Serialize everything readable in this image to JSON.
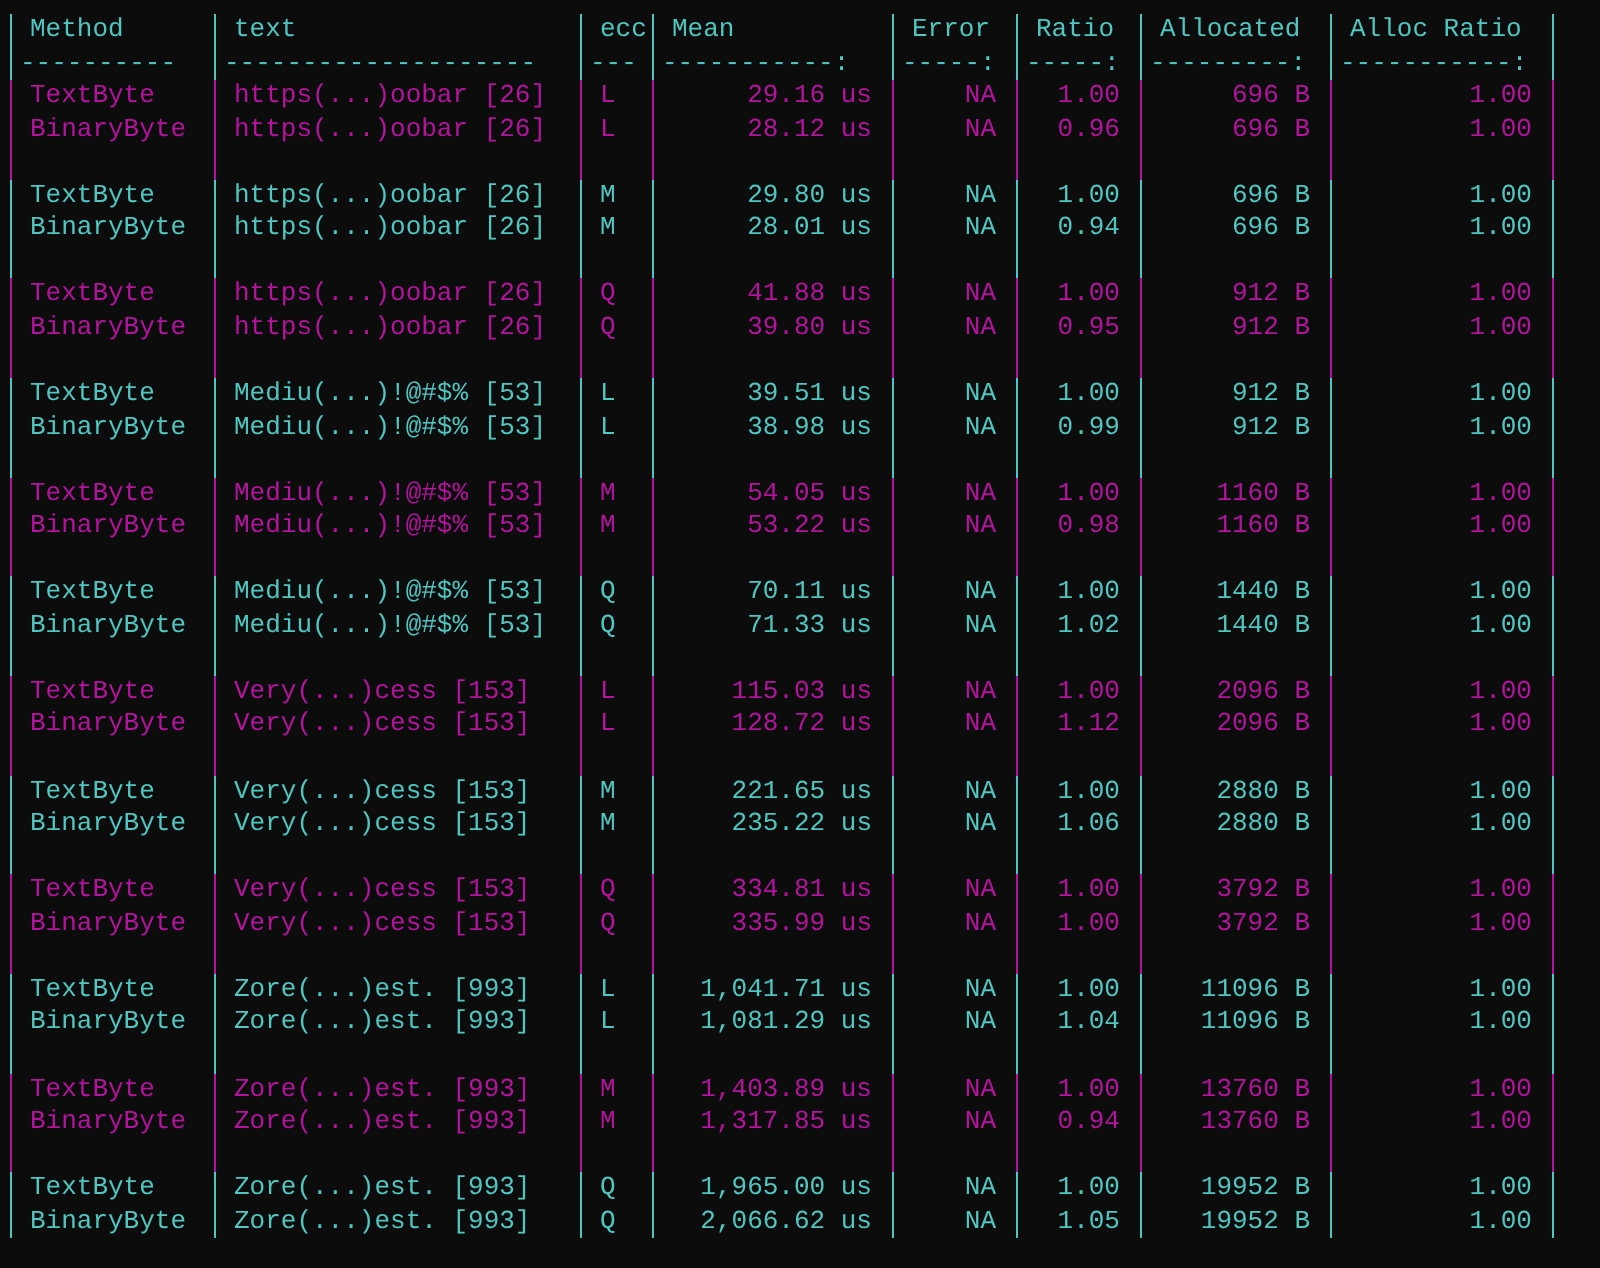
{
  "table": {
    "columns": [
      {
        "label": "Method",
        "rule": "----------",
        "right_aligned": false
      },
      {
        "label": "text",
        "rule": "--------------------",
        "right_aligned": false
      },
      {
        "label": "ecc",
        "rule": "---",
        "right_aligned": false
      },
      {
        "label": "Mean",
        "rule": "-----------:",
        "right_aligned": true
      },
      {
        "label": "Error",
        "rule": "-----:",
        "right_aligned": true
      },
      {
        "label": "Ratio",
        "rule": "-----:",
        "right_aligned": true
      },
      {
        "label": "Allocated",
        "rule": "---------:",
        "right_aligned": true
      },
      {
        "label": "Alloc Ratio",
        "rule": "-----------:",
        "right_aligned": true
      }
    ],
    "groups": [
      {
        "color": "#b4139e",
        "rows": [
          [
            "TextByte",
            "https(...)oobar [26]",
            "L",
            "29.16 us",
            "NA",
            "1.00",
            "696 B",
            "1.00"
          ],
          [
            "BinaryByte",
            "https(...)oobar [26]",
            "L",
            "28.12 us",
            "NA",
            "0.96",
            "696 B",
            "1.00"
          ]
        ]
      },
      {
        "color": "#4fc6c0",
        "rows": [
          [
            "TextByte",
            "https(...)oobar [26]",
            "M",
            "29.80 us",
            "NA",
            "1.00",
            "696 B",
            "1.00"
          ],
          [
            "BinaryByte",
            "https(...)oobar [26]",
            "M",
            "28.01 us",
            "NA",
            "0.94",
            "696 B",
            "1.00"
          ]
        ]
      },
      {
        "color": "#b4139e",
        "rows": [
          [
            "TextByte",
            "https(...)oobar [26]",
            "Q",
            "41.88 us",
            "NA",
            "1.00",
            "912 B",
            "1.00"
          ],
          [
            "BinaryByte",
            "https(...)oobar [26]",
            "Q",
            "39.80 us",
            "NA",
            "0.95",
            "912 B",
            "1.00"
          ]
        ]
      },
      {
        "color": "#4fc6c0",
        "rows": [
          [
            "TextByte",
            "Mediu(...)!@#$% [53]",
            "L",
            "39.51 us",
            "NA",
            "1.00",
            "912 B",
            "1.00"
          ],
          [
            "BinaryByte",
            "Mediu(...)!@#$% [53]",
            "L",
            "38.98 us",
            "NA",
            "0.99",
            "912 B",
            "1.00"
          ]
        ]
      },
      {
        "color": "#b4139e",
        "rows": [
          [
            "TextByte",
            "Mediu(...)!@#$% [53]",
            "M",
            "54.05 us",
            "NA",
            "1.00",
            "1160 B",
            "1.00"
          ],
          [
            "BinaryByte",
            "Mediu(...)!@#$% [53]",
            "M",
            "53.22 us",
            "NA",
            "0.98",
            "1160 B",
            "1.00"
          ]
        ]
      },
      {
        "color": "#4fc6c0",
        "rows": [
          [
            "TextByte",
            "Mediu(...)!@#$% [53]",
            "Q",
            "70.11 us",
            "NA",
            "1.00",
            "1440 B",
            "1.00"
          ],
          [
            "BinaryByte",
            "Mediu(...)!@#$% [53]",
            "Q",
            "71.33 us",
            "NA",
            "1.02",
            "1440 B",
            "1.00"
          ]
        ]
      },
      {
        "color": "#b4139e",
        "rows": [
          [
            "TextByte",
            "Very(...)cess [153]",
            "L",
            "115.03 us",
            "NA",
            "1.00",
            "2096 B",
            "1.00"
          ],
          [
            "BinaryByte",
            "Very(...)cess [153]",
            "L",
            "128.72 us",
            "NA",
            "1.12",
            "2096 B",
            "1.00"
          ]
        ]
      },
      {
        "color": "#4fc6c0",
        "rows": [
          [
            "TextByte",
            "Very(...)cess [153]",
            "M",
            "221.65 us",
            "NA",
            "1.00",
            "2880 B",
            "1.00"
          ],
          [
            "BinaryByte",
            "Very(...)cess [153]",
            "M",
            "235.22 us",
            "NA",
            "1.06",
            "2880 B",
            "1.00"
          ]
        ]
      },
      {
        "color": "#b4139e",
        "rows": [
          [
            "TextByte",
            "Very(...)cess [153]",
            "Q",
            "334.81 us",
            "NA",
            "1.00",
            "3792 B",
            "1.00"
          ],
          [
            "BinaryByte",
            "Very(...)cess [153]",
            "Q",
            "335.99 us",
            "NA",
            "1.00",
            "3792 B",
            "1.00"
          ]
        ]
      },
      {
        "color": "#4fc6c0",
        "rows": [
          [
            "TextByte",
            "Zore(...)est. [993]",
            "L",
            "1,041.71 us",
            "NA",
            "1.00",
            "11096 B",
            "1.00"
          ],
          [
            "BinaryByte",
            "Zore(...)est. [993]",
            "L",
            "1,081.29 us",
            "NA",
            "1.04",
            "11096 B",
            "1.00"
          ]
        ]
      },
      {
        "color": "#b4139e",
        "rows": [
          [
            "TextByte",
            "Zore(...)est. [993]",
            "M",
            "1,403.89 us",
            "NA",
            "1.00",
            "13760 B",
            "1.00"
          ],
          [
            "BinaryByte",
            "Zore(...)est. [993]",
            "M",
            "1,317.85 us",
            "NA",
            "0.94",
            "13760 B",
            "1.00"
          ]
        ]
      },
      {
        "color": "#4fc6c0",
        "rows": [
          [
            "TextByte",
            "Zore(...)est. [993]",
            "Q",
            "1,965.00 us",
            "NA",
            "1.00",
            "19952 B",
            "1.00"
          ],
          [
            "BinaryByte",
            "Zore(...)est. [993]",
            "Q",
            "2,066.62 us",
            "NA",
            "1.05",
            "19952 B",
            "1.00"
          ]
        ]
      }
    ]
  }
}
